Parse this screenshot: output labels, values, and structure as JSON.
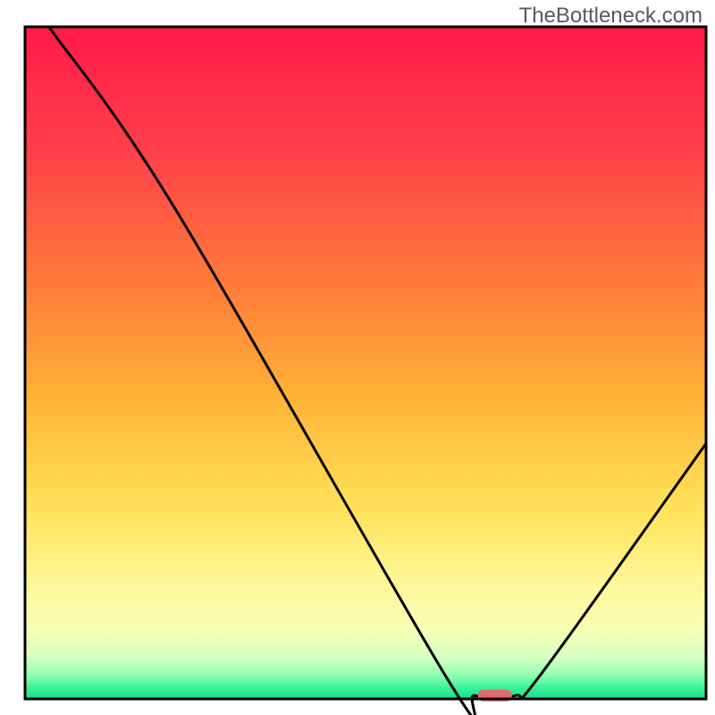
{
  "watermark": "TheBottleneck.com",
  "chart_data": {
    "type": "line",
    "title": "",
    "xlabel": "",
    "ylabel": "",
    "xlim": [
      0,
      100
    ],
    "ylim": [
      0,
      100
    ],
    "curve": {
      "name": "bottleneck-curve",
      "points": [
        {
          "x": 3.5,
          "y": 100
        },
        {
          "x": 22,
          "y": 73
        },
        {
          "x": 62,
          "y": 3
        },
        {
          "x": 66,
          "y": 0.5
        },
        {
          "x": 72,
          "y": 0.5
        },
        {
          "x": 76,
          "y": 4
        },
        {
          "x": 100,
          "y": 38
        }
      ]
    },
    "marker": {
      "x": 69,
      "y": 0.5,
      "color": "#e26a6a"
    },
    "gradient_stops": [
      {
        "offset": 0.0,
        "color": "#ff1a4a"
      },
      {
        "offset": 0.18,
        "color": "#ff3f49"
      },
      {
        "offset": 0.38,
        "color": "#ff7a3a"
      },
      {
        "offset": 0.55,
        "color": "#ffb236"
      },
      {
        "offset": 0.72,
        "color": "#ffe35a"
      },
      {
        "offset": 0.83,
        "color": "#fff79a"
      },
      {
        "offset": 0.9,
        "color": "#f6ffb6"
      },
      {
        "offset": 0.94,
        "color": "#d2ffc0"
      },
      {
        "offset": 0.965,
        "color": "#8effb0"
      },
      {
        "offset": 0.985,
        "color": "#35f09a"
      },
      {
        "offset": 1.0,
        "color": "#18e08c"
      }
    ],
    "frame": {
      "stroke": "#000000",
      "width": 3
    }
  }
}
